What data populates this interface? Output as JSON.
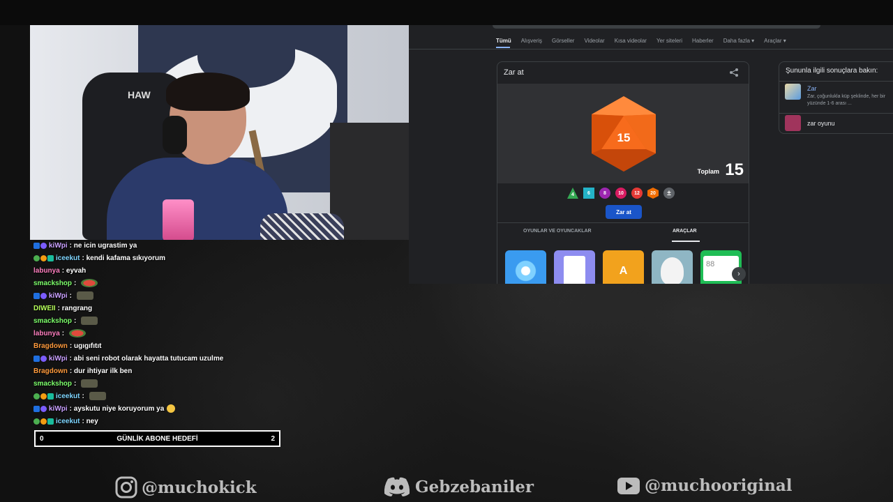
{
  "browser": {
    "tabs": [
      "Tümü",
      "Alışveriş",
      "Görseller",
      "Videolar",
      "Kısa videolar",
      "Yer siteleri",
      "Haberler",
      "Daha fazla ▾",
      "Araçlar ▾"
    ],
    "dice_card": {
      "title": "Zar at",
      "die_value": "15",
      "total_label": "Toplam",
      "total_value": "15",
      "dice_options": [
        "4",
        "6",
        "8",
        "10",
        "12",
        "20",
        "±"
      ],
      "roll_button": "Zar at",
      "subtabs": [
        "OYUNLAR VE OYUNCAKLAR",
        "ARAÇLAR"
      ],
      "app_labels": [
        "A",
        "88"
      ],
      "next_arrow": "›"
    },
    "side_panel": {
      "title": "Şununla ilgili sonuçlara bakın:",
      "link": "Zar",
      "desc": "Zar, çoğunlukla küp şeklinde, her bir yüzünde 1-6 arası ...",
      "item2": "zar oyunu"
    }
  },
  "webcam": {
    "chair_logo": "HAW"
  },
  "chat": [
    {
      "user": "kiWpi",
      "color": "#c9a0ff",
      "text": "ne icin ugrastim ya",
      "badges": [
        "blue",
        "purple"
      ],
      "emote": ""
    },
    {
      "user": "iceekut",
      "color": "#7fd6ff",
      "text": "kendi kafama sıkıyorum",
      "badges": [
        "green",
        "orange",
        "teal"
      ],
      "emote": ""
    },
    {
      "user": "labunya",
      "color": "#ff7fbf",
      "text": "eyvah",
      "badges": [],
      "emote": ""
    },
    {
      "user": "smackshop",
      "color": "#7dff6b",
      "text": "",
      "badges": [],
      "emote": "red"
    },
    {
      "user": "kiWpi",
      "color": "#c9a0ff",
      "text": "",
      "badges": [
        "blue",
        "purple"
      ],
      "emote": "tank"
    },
    {
      "user": "DIWEII",
      "color": "#b6ff5a",
      "text": "rangrang",
      "badges": [],
      "emote": ""
    },
    {
      "user": "smackshop",
      "color": "#7dff6b",
      "text": "",
      "badges": [],
      "emote": "tank"
    },
    {
      "user": "labunya",
      "color": "#ff7fbf",
      "text": "",
      "badges": [],
      "emote": "red"
    },
    {
      "user": "Bragdown",
      "color": "#ff9a3c",
      "text": "ugıgıfıtıt",
      "badges": [],
      "emote": ""
    },
    {
      "user": "kiWpi",
      "color": "#c9a0ff",
      "text": "abi seni robot olarak hayatta tutucam uzulme",
      "badges": [
        "blue",
        "purple"
      ],
      "emote": ""
    },
    {
      "user": "Bragdown",
      "color": "#ff9a3c",
      "text": "dur ihtiyar ilk ben",
      "badges": [],
      "emote": ""
    },
    {
      "user": "smackshop",
      "color": "#7dff6b",
      "text": "",
      "badges": [],
      "emote": "tank"
    },
    {
      "user": "iceekut",
      "color": "#7fd6ff",
      "text": "",
      "badges": [
        "green",
        "orange",
        "teal"
      ],
      "emote": "tank"
    },
    {
      "user": "kiWpi",
      "color": "#c9a0ff",
      "text": "ayskutu niye koruyorum ya",
      "badges": [
        "blue",
        "purple"
      ],
      "emote": "face"
    },
    {
      "user": "iceekut",
      "color": "#7fd6ff",
      "text": "ney",
      "badges": [
        "green",
        "orange",
        "teal"
      ],
      "emote": ""
    }
  ],
  "goal": {
    "left": "0",
    "label": "GÜNLİK ABONE HEDEFİ",
    "right": "2"
  },
  "socials": {
    "instagram": "@muchokick",
    "discord": "Gebzebaniler",
    "youtube": "@muchooriginal"
  },
  "colors": {
    "accent_blue": "#1a55c8",
    "d20_orange": "#e8590c"
  },
  "icons": [
    "share-icon",
    "instagram-icon",
    "discord-icon",
    "youtube-icon"
  ]
}
